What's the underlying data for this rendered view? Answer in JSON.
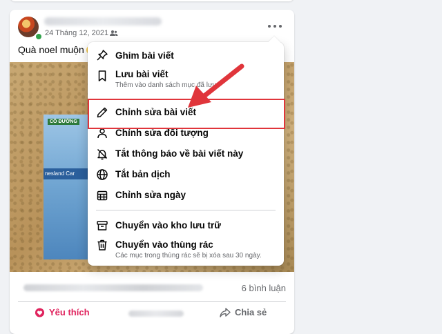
{
  "post": {
    "date": "24 Tháng 12, 2021 ·",
    "text": "Quà noel muộn",
    "comments_count": "6 bình luận",
    "like_label": "Yêu thích",
    "share_label": "Chia sẻ",
    "photo": {
      "box_brand": "CÔ ĐƯỜNG",
      "box_stripe": "nesland Car"
    }
  },
  "menu": {
    "items": [
      {
        "label": "Ghim bài viết",
        "icon": "pin-icon"
      },
      {
        "label": "Lưu bài viết",
        "sub": "Thêm vào danh sách mục đã lưu",
        "icon": "bookmark-icon"
      },
      {
        "label": "Chỉnh sửa bài viết",
        "icon": "pencil-icon"
      },
      {
        "label": "Chỉnh sửa đối tượng",
        "icon": "audience-icon"
      },
      {
        "label": "Tắt thông báo về bài viết này",
        "icon": "bell-off-icon"
      },
      {
        "label": "Tắt bản dịch",
        "icon": "globe-icon"
      },
      {
        "label": "Chỉnh sửa ngày",
        "icon": "calendar-icon"
      },
      {
        "label": "Chuyển vào kho lưu trữ",
        "icon": "archive-icon"
      },
      {
        "label": "Chuyển vào thùng rác",
        "sub": "Các mục trong thùng rác sẽ bị xóa sau 30 ngày.",
        "icon": "trash-icon"
      }
    ]
  },
  "colors": {
    "highlight": "#e0353b",
    "like": "#e0245e",
    "online": "#31a24c"
  }
}
